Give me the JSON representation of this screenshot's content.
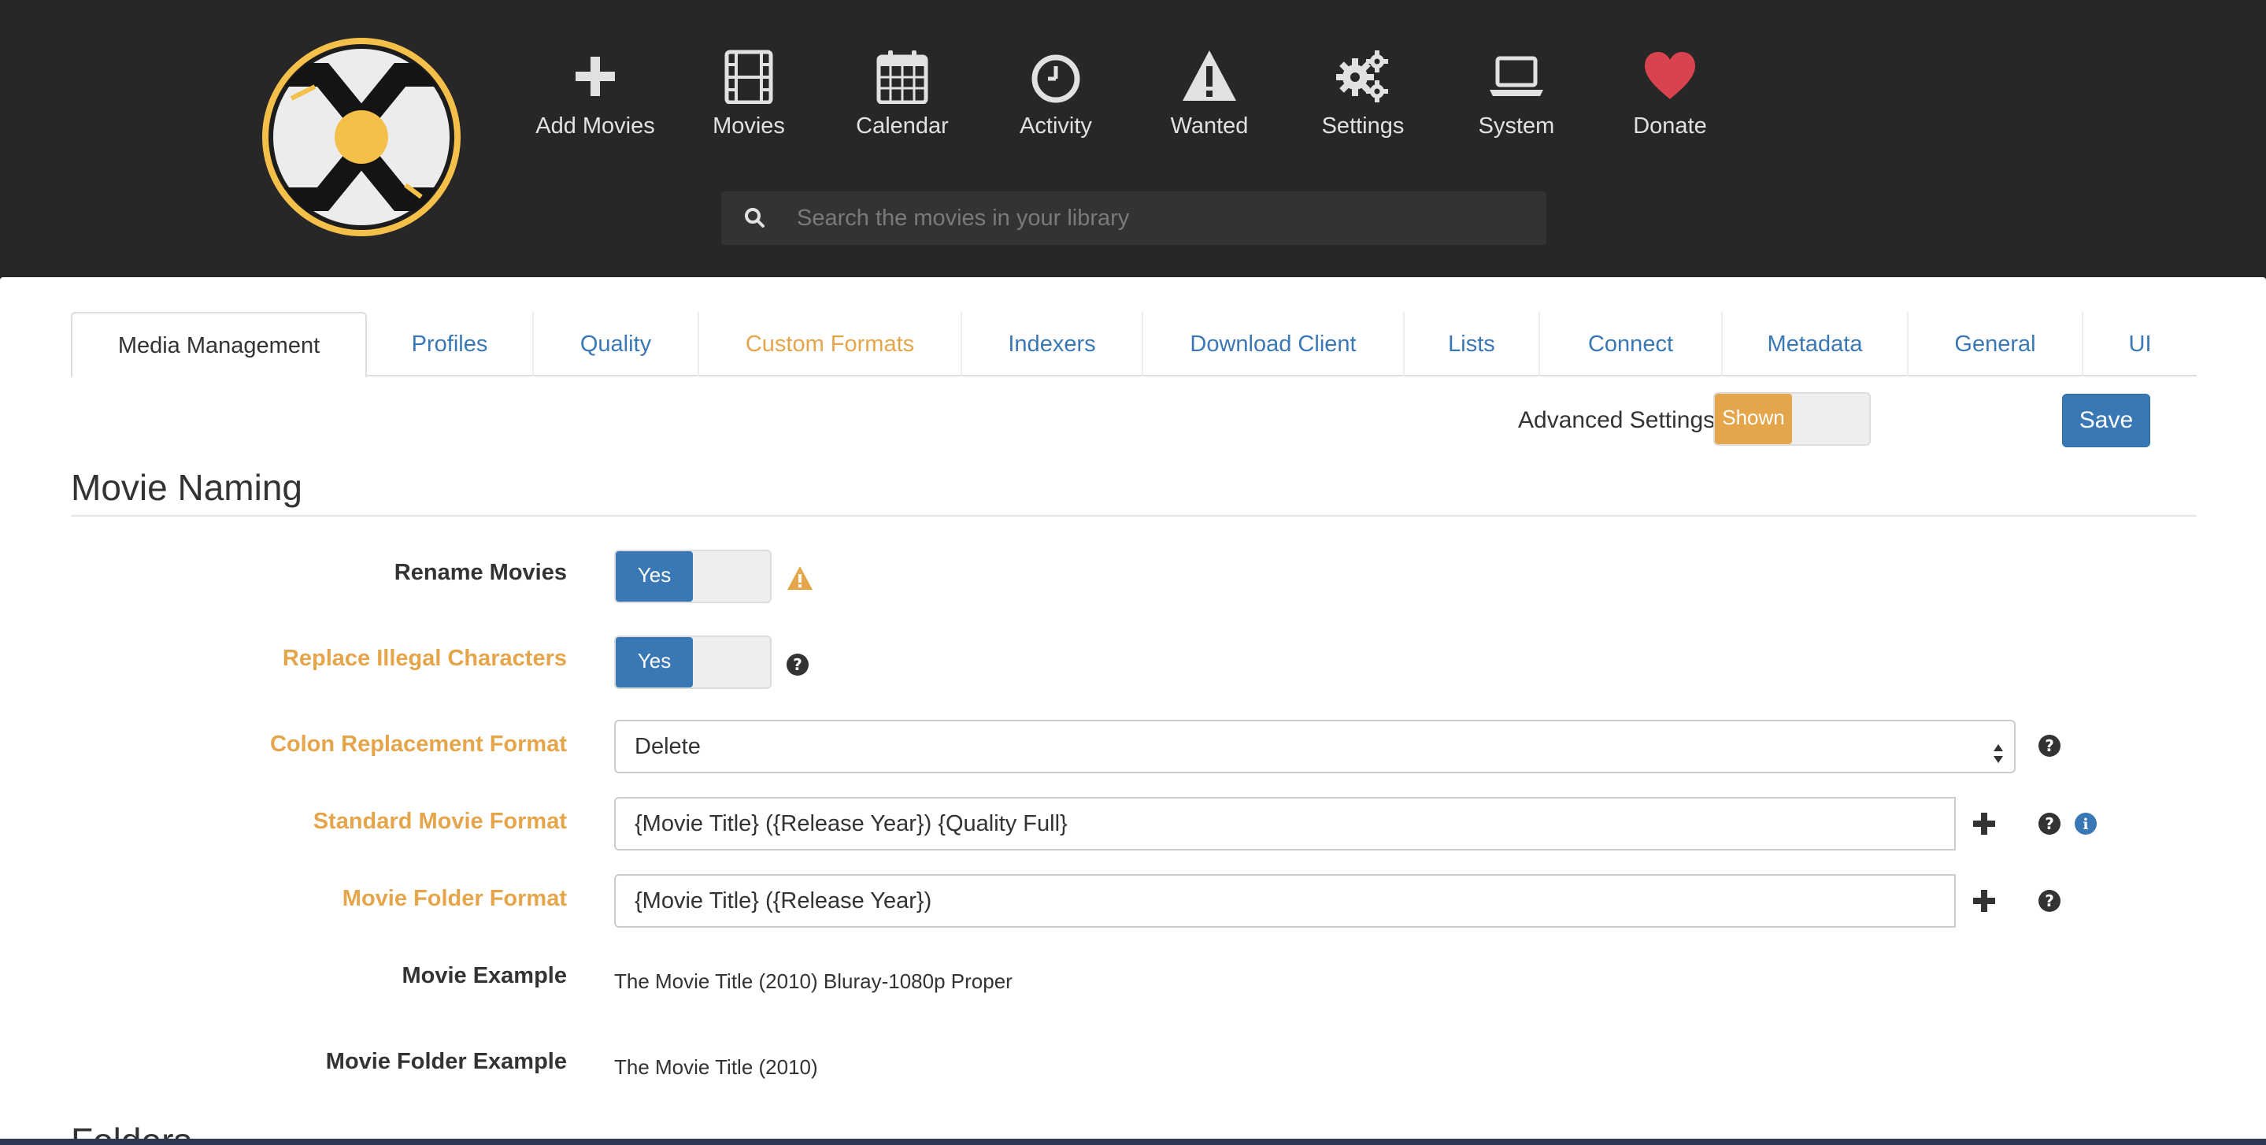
{
  "nav": {
    "items": [
      {
        "label": "Add Movies",
        "icon": "plus-icon"
      },
      {
        "label": "Movies",
        "icon": "film-icon"
      },
      {
        "label": "Calendar",
        "icon": "calendar-icon"
      },
      {
        "label": "Activity",
        "icon": "clock-icon"
      },
      {
        "label": "Wanted",
        "icon": "warning-icon"
      },
      {
        "label": "Settings",
        "icon": "gears-icon"
      },
      {
        "label": "System",
        "icon": "laptop-icon"
      },
      {
        "label": "Donate",
        "icon": "heart-icon"
      }
    ],
    "donate_color": "#d9434d"
  },
  "search": {
    "placeholder": "Search the movies in your library"
  },
  "tabs": [
    {
      "label": "Media Management"
    },
    {
      "label": "Profiles"
    },
    {
      "label": "Quality"
    },
    {
      "label": "Custom Formats"
    },
    {
      "label": "Indexers"
    },
    {
      "label": "Download Client"
    },
    {
      "label": "Lists"
    },
    {
      "label": "Connect"
    },
    {
      "label": "Metadata"
    },
    {
      "label": "General"
    },
    {
      "label": "UI"
    }
  ],
  "advanced": {
    "label": "Advanced Settings",
    "toggle_text": "Shown"
  },
  "save_label": "Save",
  "section": {
    "title": "Movie Naming"
  },
  "form": {
    "rename_movies": {
      "label": "Rename Movies",
      "toggle_text": "Yes"
    },
    "replace_illegal": {
      "label": "Replace Illegal Characters",
      "toggle_text": "Yes"
    },
    "colon_replacement": {
      "label": "Colon Replacement Format",
      "value": "Delete"
    },
    "standard_format": {
      "label": "Standard Movie Format",
      "value": "{Movie Title} ({Release Year}) {Quality Full}"
    },
    "folder_format": {
      "label": "Movie Folder Format",
      "value": "{Movie Title} ({Release Year})"
    },
    "movie_example": {
      "label": "Movie Example",
      "value": "The Movie Title (2010) Bluray-1080p Proper"
    },
    "folder_example": {
      "label": "Movie Folder Example",
      "value": "The Movie Title (2010)"
    }
  },
  "next_section": {
    "title": "Folders"
  },
  "colors": {
    "accent_blue": "#3a78b5",
    "advanced_orange": "#e5a54a",
    "header_bg": "#272727",
    "logo_yellow": "#f5c04a"
  }
}
